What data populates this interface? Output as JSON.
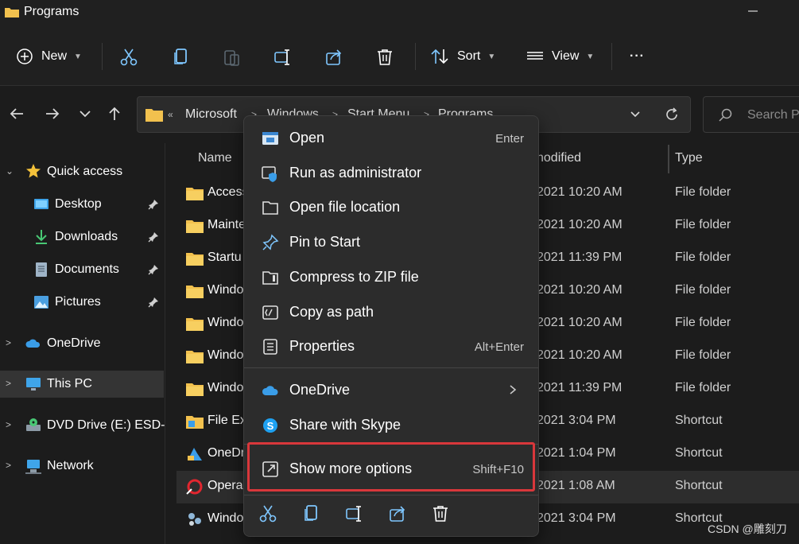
{
  "window": {
    "title": "Programs"
  },
  "toolbar": {
    "new_label": "New",
    "sort_label": "Sort",
    "view_label": "View",
    "more_label": "···"
  },
  "address": {
    "crumbs": [
      "Microsoft",
      "Windows",
      "Start Menu",
      "Programs"
    ],
    "search_placeholder": "Search P"
  },
  "nav": {
    "quick_access": "Quick access",
    "desktop": "Desktop",
    "downloads": "Downloads",
    "documents": "Documents",
    "pictures": "Pictures",
    "onedrive": "OneDrive",
    "this_pc": "This PC",
    "dvd": "DVD Drive (E:) ESD-",
    "network": "Network"
  },
  "columns": {
    "name": "Name",
    "modified": "nodified",
    "type": "Type"
  },
  "files": [
    {
      "name": "Access",
      "date": "2021 10:20 AM",
      "type": "File folder"
    },
    {
      "name": "Mainte",
      "date": "2021 10:20 AM",
      "type": "File folder"
    },
    {
      "name": "Startu",
      "date": "2021 11:39 PM",
      "type": "File folder"
    },
    {
      "name": "Windo",
      "date": "2021 10:20 AM",
      "type": "File folder"
    },
    {
      "name": "Windo",
      "date": "2021 10:20 AM",
      "type": "File folder"
    },
    {
      "name": "Windo",
      "date": "2021 10:20 AM",
      "type": "File folder"
    },
    {
      "name": "Windo",
      "date": "2021 11:39 PM",
      "type": "File folder"
    },
    {
      "name": "File Ex",
      "date": "2021 3:04 PM",
      "type": "Shortcut"
    },
    {
      "name": "OneDr",
      "date": "2021 1:04 PM",
      "type": "Shortcut"
    },
    {
      "name": "Opera",
      "date": "2021 1:08 AM",
      "type": "Shortcut"
    },
    {
      "name": "Windo",
      "date": "2021 3:04 PM",
      "type": "Shortcut"
    }
  ],
  "context_menu": {
    "open": {
      "label": "Open",
      "key": "Enter"
    },
    "run_admin": {
      "label": "Run as administrator"
    },
    "open_location": {
      "label": "Open file location"
    },
    "pin_start": {
      "label": "Pin to Start"
    },
    "compress_zip": {
      "label": "Compress to ZIP file"
    },
    "copy_path": {
      "label": "Copy as path"
    },
    "properties": {
      "label": "Properties",
      "key": "Alt+Enter"
    },
    "onedrive": {
      "label": "OneDrive"
    },
    "share_skype": {
      "label": "Share with Skype"
    },
    "show_more": {
      "label": "Show more options",
      "key": "Shift+F10"
    }
  },
  "colors": {
    "background": "#1c1c1c",
    "menu": "#2c2c2c",
    "highlight_box": "#d9373b",
    "folder": "#f2c14e",
    "accent": "#4cc2ff"
  },
  "watermark": "CSDN @雕刻刀"
}
